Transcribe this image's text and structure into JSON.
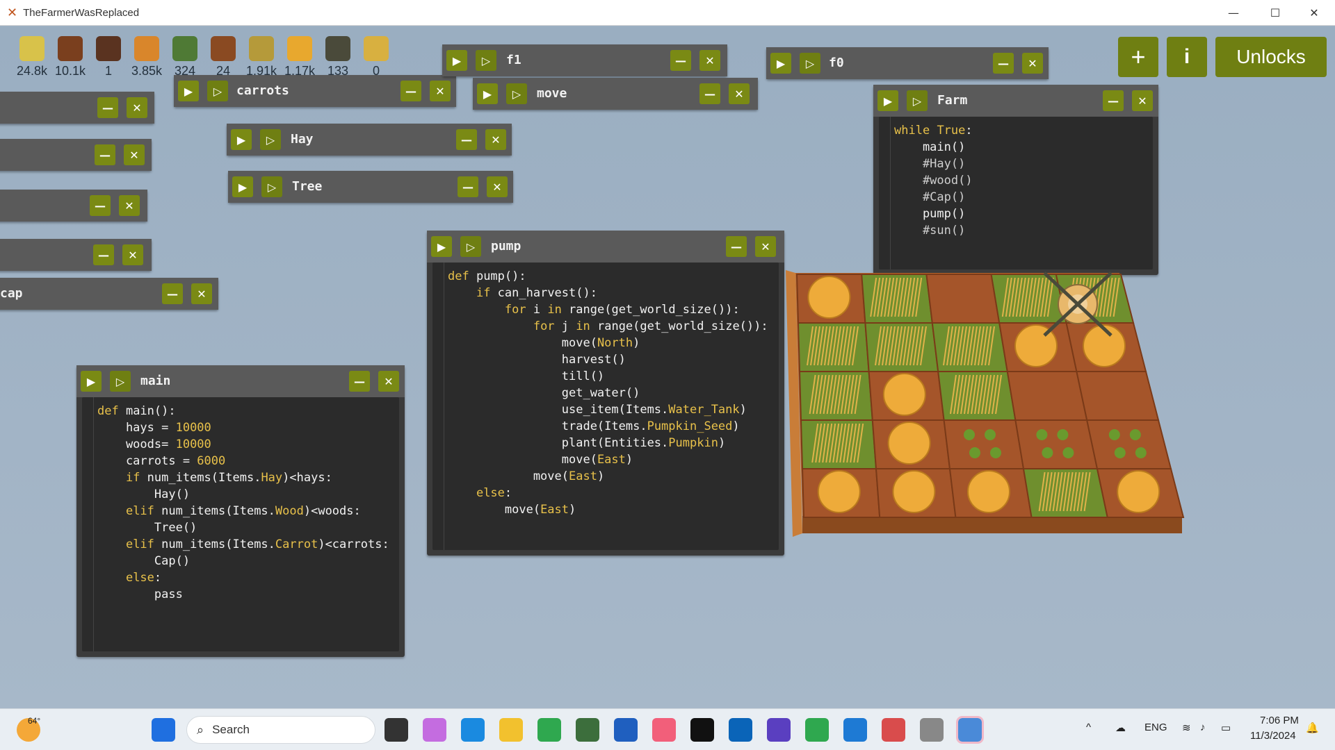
{
  "window": {
    "title": "TheFarmerWasReplaced"
  },
  "resources": [
    {
      "name": "hay-icon",
      "value": "24.8k",
      "color": "#d8c24a"
    },
    {
      "name": "wood-icon",
      "value": "10.1k",
      "color": "#7a3f1e"
    },
    {
      "name": "seed-icon",
      "value": "1",
      "color": "#5a3320"
    },
    {
      "name": "carrot-icon",
      "value": "3.85k",
      "color": "#d9862b"
    },
    {
      "name": "water-tank-icon",
      "value": "324",
      "color": "#4f7a35"
    },
    {
      "name": "empty-tank-icon",
      "value": "24",
      "color": "#8a4a22"
    },
    {
      "name": "fertilizer-icon",
      "value": "1.91k",
      "color": "#b59a3a"
    },
    {
      "name": "pumpkin-icon",
      "value": "1.17k",
      "color": "#e8a82e"
    },
    {
      "name": "bug-icon",
      "value": "133",
      "color": "#4a4a3a"
    },
    {
      "name": "gold-icon",
      "value": "0",
      "color": "#d8b040"
    }
  ],
  "top_buttons": {
    "add": "+",
    "info": "i",
    "unlocks": "Unlocks"
  },
  "windows": {
    "f1": {
      "name": "f1"
    },
    "f0": {
      "name": "f0"
    },
    "carrots": {
      "name": "carrots"
    },
    "move": {
      "name": "move"
    },
    "hay": {
      "name": "Hay"
    },
    "tree": {
      "name": "Tree"
    },
    "cap": {
      "name": "cap"
    },
    "main": {
      "name": "main"
    },
    "pump": {
      "name": "pump"
    },
    "farm": {
      "name": "Farm"
    }
  },
  "code": {
    "farm": [
      "while True:",
      "    main()",
      "    #Hay()",
      "    #wood()",
      "    #Cap()",
      "    pump()",
      "    #sun()"
    ],
    "main": [
      "def main():",
      "    hays = 10000",
      "    woods= 10000",
      "    carrots = 6000",
      "    if num_items(Items.Hay)<hays:",
      "        Hay()",
      "    elif num_items(Items.Wood)<woods:",
      "        Tree()",
      "    elif num_items(Items.Carrot)<carrots:",
      "        Cap()",
      "    else:",
      "        pass"
    ],
    "pump": [
      "def pump():",
      "    if can_harvest():",
      "        for i in range(get_world_size()):",
      "            for j in range(get_world_size()):",
      "                move(North)",
      "                harvest()",
      "                till()",
      "                get_water()",
      "                use_item(Items.Water_Tank)",
      "                trade(Items.Pumpkin_Seed)",
      "                plant(Entities.Pumpkin)",
      "                move(East)",
      "            move(East)",
      "    else:",
      "        move(East)"
    ]
  },
  "taskbar": {
    "weather": "64°",
    "search_label": "Search",
    "language": "ENG",
    "time": "7:06 PM",
    "date": "11/3/2024"
  }
}
